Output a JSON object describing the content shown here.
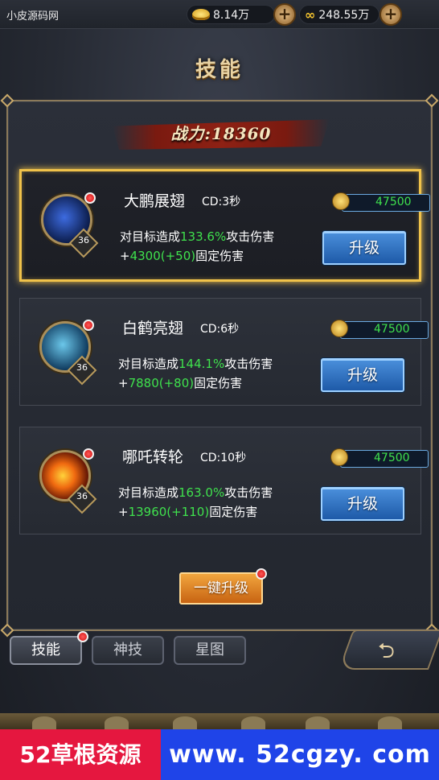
{
  "topbar": {
    "site_name": "小皮源码网",
    "gold": "8.14万",
    "coins": "248.55万",
    "plus": "+"
  },
  "title": "技能",
  "power": "战力:18360",
  "skills": [
    {
      "name": "大鹏展翅",
      "cd": "CD:3秒",
      "level": "36",
      "cost": "47500",
      "desc_prefix": "对目标造成",
      "percent": "133.6%",
      "desc_mid": "攻击伤害",
      "plus_prefix": "+",
      "flat": "4300(+50)",
      "flat_suffix": "固定伤害",
      "button": "升级",
      "selected": true
    },
    {
      "name": "白鹤亮翅",
      "cd": "CD:6秒",
      "level": "36",
      "cost": "47500",
      "desc_prefix": "对目标造成",
      "percent": "144.1%",
      "desc_mid": "攻击伤害",
      "plus_prefix": "+",
      "flat": "7880(+80)",
      "flat_suffix": "固定伤害",
      "button": "升级",
      "selected": false
    },
    {
      "name": "哪吒转轮",
      "cd": "CD:10秒",
      "level": "36",
      "cost": "47500",
      "desc_prefix": "对目标造成",
      "percent": "163.0%",
      "desc_mid": "攻击伤害",
      "plus_prefix": "+",
      "flat": "13960(+110)",
      "flat_suffix": "固定伤害",
      "button": "升级",
      "selected": false
    }
  ],
  "onekey_button": "一键升级",
  "tabs": [
    {
      "label": "技能",
      "active": true
    },
    {
      "label": "神技",
      "active": false
    },
    {
      "label": "星图",
      "active": false
    }
  ],
  "watermark": {
    "left": "52草根资源",
    "right": "www. 52cgzy. com"
  },
  "colors": {
    "highlight_border": "#f0c24a",
    "value_green": "#3fe14d",
    "upgrade_blue": "#2e73c4",
    "onekey_orange": "#e08a2a",
    "notice_red": "#e0201e"
  },
  "icons": {
    "gold": "gold-ingot-icon",
    "coin": "coin-icon",
    "plus": "plus-icon",
    "back": "return-arrow-icon",
    "notice": "red-dot-icon"
  }
}
